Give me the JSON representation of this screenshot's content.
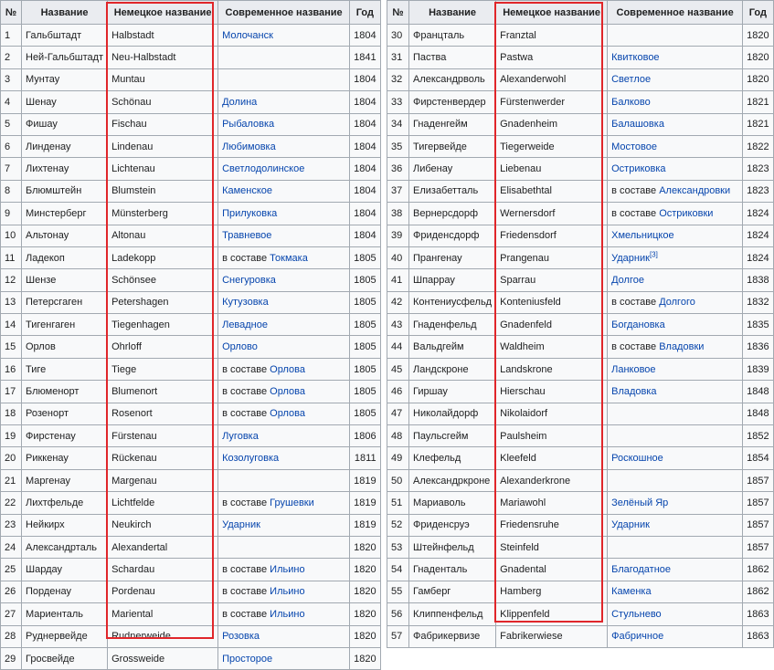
{
  "headers": [
    "№",
    "Название",
    "Немецкое название",
    "Современное название",
    "Год"
  ],
  "left_rows": [
    {
      "n": "1",
      "ru": "Гальбштадт",
      "de": "Halbstadt",
      "pre": "",
      "link": "Молочанск",
      "sup": "",
      "year": "1804"
    },
    {
      "n": "2",
      "ru": "Ней-Гальбштадт",
      "de": "Neu-Halbstadt",
      "pre": "",
      "link": "",
      "sup": "",
      "year": "1841"
    },
    {
      "n": "3",
      "ru": "Мунтау",
      "de": "Muntau",
      "pre": "",
      "link": "",
      "sup": "",
      "year": "1804"
    },
    {
      "n": "4",
      "ru": "Шенау",
      "de": "Schönau",
      "pre": "",
      "link": "Долина",
      "sup": "",
      "year": "1804"
    },
    {
      "n": "5",
      "ru": "Фишау",
      "de": "Fischau",
      "pre": "",
      "link": "Рыбаловка",
      "sup": "",
      "year": "1804"
    },
    {
      "n": "6",
      "ru": "Линденау",
      "de": "Lindenau",
      "pre": "",
      "link": "Любимовка",
      "sup": "",
      "year": "1804"
    },
    {
      "n": "7",
      "ru": "Лихтенау",
      "de": "Lichtenau",
      "pre": "",
      "link": "Светлодолинское",
      "sup": "",
      "year": "1804"
    },
    {
      "n": "8",
      "ru": "Блюмштейн",
      "de": "Blumstein",
      "pre": "",
      "link": "Каменское",
      "sup": "",
      "year": "1804"
    },
    {
      "n": "9",
      "ru": "Минстерберг",
      "de": "Münsterberg",
      "pre": "",
      "link": "Прилуковка",
      "sup": "",
      "year": "1804"
    },
    {
      "n": "10",
      "ru": "Альтонау",
      "de": "Altonau",
      "pre": "",
      "link": "Травневое",
      "sup": "",
      "year": "1804"
    },
    {
      "n": "11",
      "ru": "Ладекоп",
      "de": "Ladekopp",
      "pre": "в составе ",
      "link": "Токмака",
      "sup": "",
      "year": "1805"
    },
    {
      "n": "12",
      "ru": "Шензе",
      "de": "Schönsee",
      "pre": "",
      "link": "Снегуровка",
      "sup": "",
      "year": "1805"
    },
    {
      "n": "13",
      "ru": "Петерсгаген",
      "de": "Petershagen",
      "pre": "",
      "link": "Кутузовка",
      "sup": "",
      "year": "1805"
    },
    {
      "n": "14",
      "ru": "Тигенгаген",
      "de": "Tiegenhagen",
      "pre": "",
      "link": "Левадное",
      "sup": "",
      "year": "1805"
    },
    {
      "n": "15",
      "ru": "Орлов",
      "de": "Ohrloff",
      "pre": "",
      "link": "Орлово",
      "sup": "",
      "year": "1805"
    },
    {
      "n": "16",
      "ru": "Тиге",
      "de": "Tiege",
      "pre": "в составе ",
      "link": "Орлова",
      "sup": "",
      "year": "1805"
    },
    {
      "n": "17",
      "ru": "Блюменорт",
      "de": "Blumenort",
      "pre": "в составе ",
      "link": "Орлова",
      "sup": "",
      "year": "1805"
    },
    {
      "n": "18",
      "ru": "Розенорт",
      "de": "Rosenort",
      "pre": "в составе ",
      "link": "Орлова",
      "sup": "",
      "year": "1805"
    },
    {
      "n": "19",
      "ru": "Фирстенау",
      "de": "Fürstenau",
      "pre": "",
      "link": "Луговка",
      "sup": "",
      "year": "1806"
    },
    {
      "n": "20",
      "ru": "Риккенау",
      "de": "Rückenau",
      "pre": "",
      "link": "Козолуговка",
      "sup": "",
      "year": "1811"
    },
    {
      "n": "21",
      "ru": "Маргенау",
      "de": "Margenau",
      "pre": "",
      "link": "",
      "sup": "",
      "year": "1819"
    },
    {
      "n": "22",
      "ru": "Лихтфельде",
      "de": "Lichtfelde",
      "pre": "в составе ",
      "link": "Грушевки",
      "sup": "",
      "year": "1819"
    },
    {
      "n": "23",
      "ru": "Нейкирх",
      "de": "Neukirch",
      "pre": "",
      "link": "Ударник",
      "sup": "",
      "year": "1819"
    },
    {
      "n": "24",
      "ru": "Александрталь",
      "de": "Alexandertal",
      "pre": "",
      "link": "",
      "sup": "",
      "year": "1820"
    },
    {
      "n": "25",
      "ru": "Шардау",
      "de": "Schardau",
      "pre": "в составе ",
      "link": "Ильино",
      "sup": "",
      "year": "1820"
    },
    {
      "n": "26",
      "ru": "Порденау",
      "de": "Pordenau",
      "pre": "в составе ",
      "link": "Ильино",
      "sup": "",
      "year": "1820"
    },
    {
      "n": "27",
      "ru": "Мариенталь",
      "de": "Mariental",
      "pre": "в составе ",
      "link": "Ильино",
      "sup": "",
      "year": "1820"
    },
    {
      "n": "28",
      "ru": "Руднервейде",
      "de": "Rudnerweide",
      "pre": "",
      "link": "Розовка",
      "sup": "",
      "year": "1820"
    },
    {
      "n": "29",
      "ru": "Гросвейде",
      "de": "Grossweide",
      "pre": "",
      "link": "Просторое",
      "sup": "",
      "year": "1820"
    }
  ],
  "right_rows": [
    {
      "n": "30",
      "ru": "Францталь",
      "de": "Franztal",
      "pre": "",
      "link": "",
      "sup": "",
      "year": "1820"
    },
    {
      "n": "31",
      "ru": "Паства",
      "de": "Pastwa",
      "pre": "",
      "link": "Квитковое",
      "sup": "",
      "year": "1820"
    },
    {
      "n": "32",
      "ru": "Александрволь",
      "de": "Alexanderwohl",
      "pre": "",
      "link": "Светлое",
      "sup": "",
      "year": "1820"
    },
    {
      "n": "33",
      "ru": "Фирстенвердер",
      "de": "Fürstenwerder",
      "pre": "",
      "link": "Балково",
      "sup": "",
      "year": "1821"
    },
    {
      "n": "34",
      "ru": "Гнаденгейм",
      "de": "Gnadenheim",
      "pre": "",
      "link": "Балашовка",
      "sup": "",
      "year": "1821"
    },
    {
      "n": "35",
      "ru": "Тигервейде",
      "de": "Tiegerweide",
      "pre": "",
      "link": "Мостовое",
      "sup": "",
      "year": "1822"
    },
    {
      "n": "36",
      "ru": "Либенау",
      "de": "Liebenau",
      "pre": "",
      "link": "Остриковка",
      "sup": "",
      "year": "1823"
    },
    {
      "n": "37",
      "ru": "Елизабетталь",
      "de": "Elisabethtal",
      "pre": "в составе ",
      "link": "Александровки",
      "sup": "",
      "year": "1823"
    },
    {
      "n": "38",
      "ru": "Вернерсдорф",
      "de": "Wernersdorf",
      "pre": "в составе ",
      "link": "Остриковки",
      "sup": "",
      "year": "1824"
    },
    {
      "n": "39",
      "ru": "Фриденсдорф",
      "de": "Friedensdorf",
      "pre": "",
      "link": "Хмельницкое",
      "sup": "",
      "year": "1824"
    },
    {
      "n": "40",
      "ru": "Прангенау",
      "de": "Prangenau",
      "pre": "",
      "link": "Ударник",
      "sup": "[3]",
      "year": "1824"
    },
    {
      "n": "41",
      "ru": "Шпаррау",
      "de": "Sparrau",
      "pre": "",
      "link": "Долгое",
      "sup": "",
      "year": "1838"
    },
    {
      "n": "42",
      "ru": "Контениусфельд",
      "de": "Konteniusfeld",
      "pre": "в составе ",
      "link": "Долгого",
      "sup": "",
      "year": "1832"
    },
    {
      "n": "43",
      "ru": "Гнаденфельд",
      "de": "Gnadenfeld",
      "pre": "",
      "link": "Богдановка",
      "sup": "",
      "year": "1835"
    },
    {
      "n": "44",
      "ru": "Вальдгейм",
      "de": "Waldheim",
      "pre": "в составе ",
      "link": "Владовки",
      "sup": "",
      "year": "1836"
    },
    {
      "n": "45",
      "ru": "Ландскроне",
      "de": "Landskrone",
      "pre": "",
      "link": "Ланковое",
      "sup": "",
      "year": "1839"
    },
    {
      "n": "46",
      "ru": "Гиршау",
      "de": "Hierschau",
      "pre": "",
      "link": "Владовка",
      "sup": "",
      "year": "1848"
    },
    {
      "n": "47",
      "ru": "Николайдорф",
      "de": "Nikolaidorf",
      "pre": "",
      "link": "",
      "sup": "",
      "year": "1848"
    },
    {
      "n": "48",
      "ru": "Паульсгейм",
      "de": "Paulsheim",
      "pre": "",
      "link": "",
      "sup": "",
      "year": "1852"
    },
    {
      "n": "49",
      "ru": "Клефельд",
      "de": "Kleefeld",
      "pre": "",
      "link": "Роскошное",
      "sup": "",
      "year": "1854"
    },
    {
      "n": "50",
      "ru": "Александркроне",
      "de": "Alexanderkrone",
      "pre": "",
      "link": "",
      "sup": "",
      "year": "1857"
    },
    {
      "n": "51",
      "ru": "Мариаволь",
      "de": "Mariawohl",
      "pre": "",
      "link": "Зелёный Яр",
      "sup": "",
      "year": "1857"
    },
    {
      "n": "52",
      "ru": "Фриденсруэ",
      "de": "Friedensruhe",
      "pre": "",
      "link": "Ударник",
      "sup": "",
      "year": "1857"
    },
    {
      "n": "53",
      "ru": "Штейнфельд",
      "de": "Steinfeld",
      "pre": "",
      "link": "",
      "sup": "",
      "year": "1857"
    },
    {
      "n": "54",
      "ru": "Гнаденталь",
      "de": "Gnadental",
      "pre": "",
      "link": "Благодатное",
      "sup": "",
      "year": "1862"
    },
    {
      "n": "55",
      "ru": "Гамберг",
      "de": "Hamberg",
      "pre": "",
      "link": "Каменка",
      "sup": "",
      "year": "1862"
    },
    {
      "n": "56",
      "ru": "Клиппенфельд",
      "de": "Klippenfeld",
      "pre": "",
      "link": "Стульнево",
      "sup": "",
      "year": "1863"
    },
    {
      "n": "57",
      "ru": "Фабрикервизе",
      "de": "Fabrikerwiese",
      "pre": "",
      "link": "Фабричное",
      "sup": "",
      "year": "1863"
    }
  ],
  "colors": {
    "link": "#0645ad",
    "highlight": "#e0262a",
    "header_bg": "#eaecf0",
    "cell_bg": "#f8f9fa",
    "border": "#a2a9b1"
  }
}
